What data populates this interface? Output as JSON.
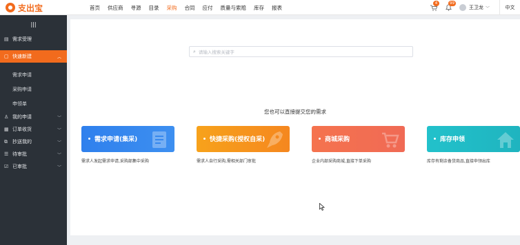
{
  "app": {
    "logo_text": "支出宝",
    "brand_color": "#f26b1d"
  },
  "nav": {
    "items": [
      "首页",
      "供应商",
      "寻源",
      "目录",
      "采购",
      "合同",
      "应付",
      "质量与索赔",
      "库存",
      "报表"
    ],
    "active": "采购"
  },
  "topbar": {
    "cart_badge": "4",
    "bell_badge": "99",
    "user_name": "王卫龙",
    "language": "中文"
  },
  "sidebar": {
    "collapse_icon": "hamburger-icon",
    "items": [
      {
        "label": "需求受理",
        "icon": "list-icon"
      },
      {
        "label": "快速新建",
        "icon": "document-icon",
        "active": true
      },
      {
        "label": "需求申请"
      },
      {
        "label": "采购申请"
      },
      {
        "label": "申领单"
      },
      {
        "label": "我的申请",
        "icon": "person-icon"
      },
      {
        "label": "订单收货",
        "icon": "box-icon"
      },
      {
        "label": "抄送我的",
        "icon": "copy-icon"
      },
      {
        "label": "待审批",
        "icon": "checklist-icon"
      },
      {
        "label": "已审批",
        "icon": "check-icon"
      }
    ]
  },
  "main": {
    "search_placeholder": "请输入搜索关键字",
    "tagline": "您也可以直接提交您的需求",
    "cards": [
      {
        "title": "需求申请(集采)",
        "desc": "需求人发起需求申请,采购部集中采购",
        "color": "#2f80ed"
      },
      {
        "title": "快捷采购(授权自采)",
        "desc": "需求人自行采购,需相关部门审批",
        "color": "#f7a21b"
      },
      {
        "title": "商城采购",
        "desc": "企业内部采购商城,直接下单采购",
        "color": "#f5734e"
      },
      {
        "title": "库存申领",
        "desc": "库存有剩余备货商品,直接申领出库",
        "color": "#22c1cb"
      }
    ]
  }
}
